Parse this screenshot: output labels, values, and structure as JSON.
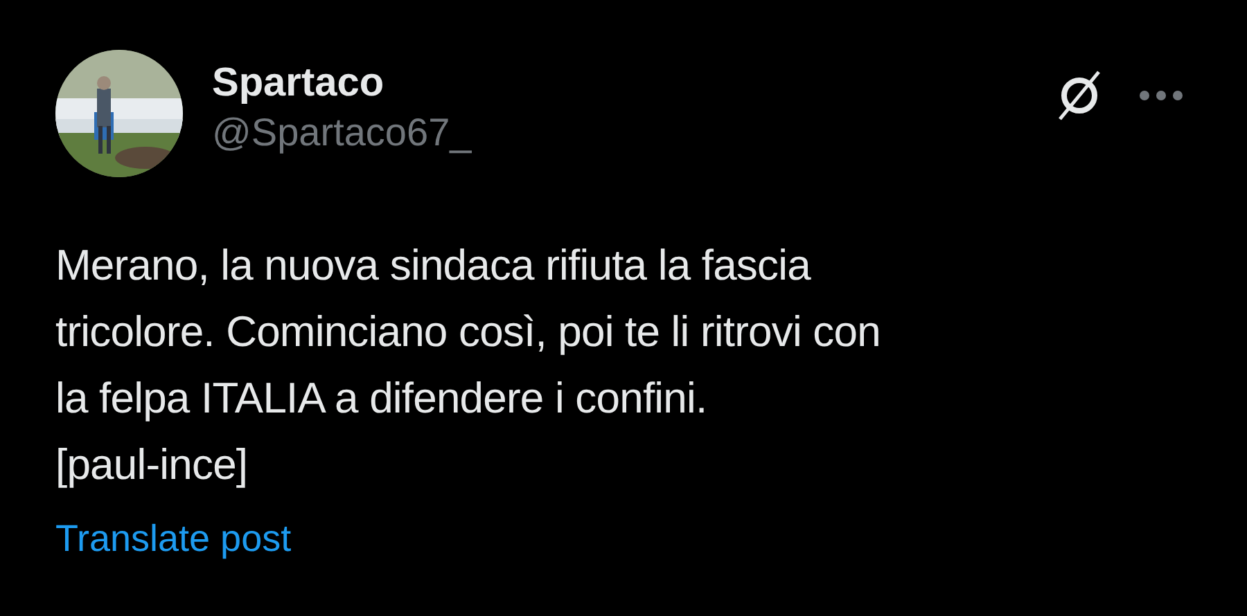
{
  "author": {
    "name": "Spartaco",
    "handle": "@Spartaco67_"
  },
  "text": "Merano, la nuova sindaca rifiuta la fascia\ntricolore. Cominciano così, poi te li ritrovi con\nla felpa ITALIA a difendere i confini.\n[paul-ince]",
  "translate_link": "Translate post"
}
